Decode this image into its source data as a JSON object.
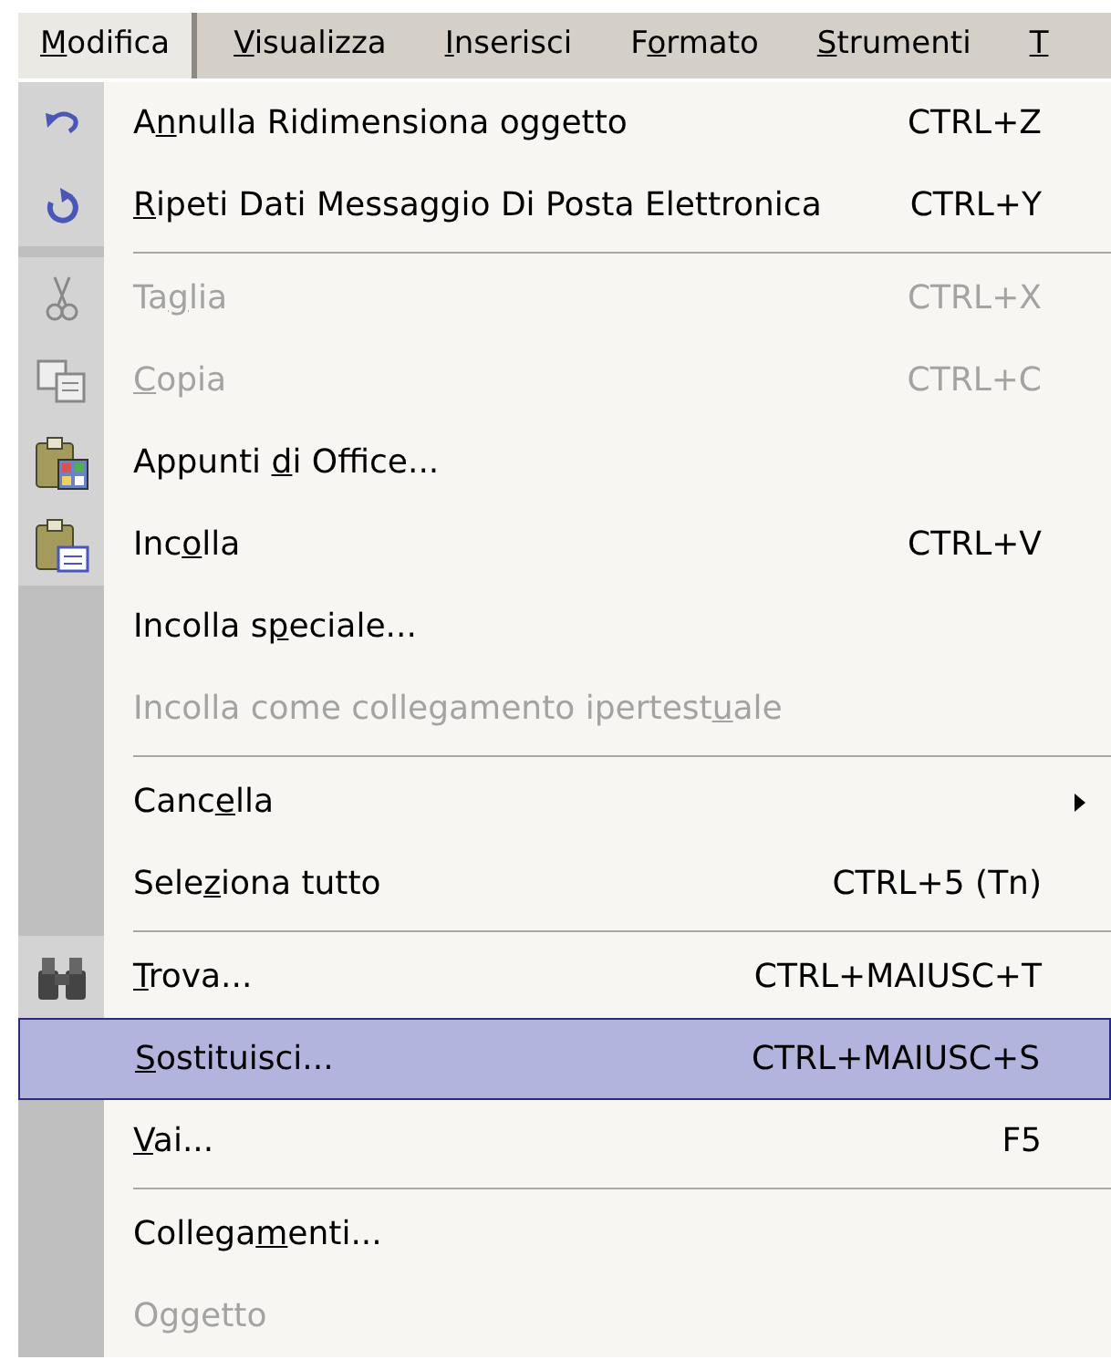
{
  "menubar": [
    {
      "key": "M",
      "after": "odifica",
      "selected": true
    },
    {
      "key": "V",
      "after": "isualizza",
      "selected": false
    },
    {
      "key": "I",
      "after": "nserisci",
      "selected": false
    },
    {
      "before": "F",
      "key": "o",
      "after": "rmato",
      "selected": false
    },
    {
      "key": "S",
      "after": "trumenti",
      "selected": false
    },
    {
      "key": "T",
      "selected": false
    }
  ],
  "menu": [
    {
      "kind": "command",
      "before": "A",
      "key": "n",
      "after": "nulla Ridimensiona oggetto",
      "shortcut": "CTRL+Z",
      "disabled": false,
      "selected": false
    },
    {
      "kind": "command",
      "key": "R",
      "after": "ipeti Dati Messaggio Di Posta Elettronica",
      "shortcut": "CTRL+Y",
      "disabled": false,
      "selected": false
    },
    {
      "kind": "separator"
    },
    {
      "kind": "command",
      "before": "Ta",
      "key": "g",
      "after": "lia",
      "shortcut": "CTRL+X",
      "disabled": true,
      "selected": false
    },
    {
      "kind": "command",
      "key": "C",
      "after": "opia",
      "shortcut": "CTRL+C",
      "disabled": true,
      "selected": false
    },
    {
      "kind": "command",
      "before": "Appunti ",
      "key": "d",
      "after": "i Office...",
      "disabled": false,
      "selected": false
    },
    {
      "kind": "command",
      "before": "Inc",
      "key": "o",
      "after": "lla",
      "shortcut": "CTRL+V",
      "disabled": false,
      "selected": false
    },
    {
      "kind": "command",
      "before": "Incolla s",
      "key": "p",
      "after": "eciale...",
      "disabled": false,
      "selected": false
    },
    {
      "kind": "command",
      "before": "Incolla come collegamento ipertest",
      "key": "u",
      "after": "ale",
      "disabled": true,
      "selected": false
    },
    {
      "kind": "separator"
    },
    {
      "kind": "command",
      "before": "Canc",
      "key": "e",
      "after": "lla",
      "submenu": true,
      "disabled": false,
      "selected": false
    },
    {
      "kind": "command",
      "before": "Sele",
      "key": "z",
      "after": "iona tutto",
      "shortcut": "CTRL+5 (Tn)",
      "disabled": false,
      "selected": false
    },
    {
      "kind": "separator"
    },
    {
      "kind": "command",
      "key": "T",
      "after": "rova...",
      "shortcut": "CTRL+MAIUSC+T",
      "disabled": false,
      "selected": false
    },
    {
      "kind": "command",
      "key": "S",
      "after": "ostituisci...",
      "shortcut": "CTRL+MAIUSC+S",
      "disabled": false,
      "selected": true
    },
    {
      "kind": "command",
      "key": "V",
      "after": "ai...",
      "shortcut": "F5",
      "disabled": false,
      "selected": false
    },
    {
      "kind": "separator"
    },
    {
      "kind": "command",
      "before": "Collega",
      "key": "m",
      "after": "enti...",
      "disabled": false,
      "selected": false
    },
    {
      "kind": "command",
      "before": "Oggetto",
      "disabled": true,
      "selected": false
    }
  ]
}
